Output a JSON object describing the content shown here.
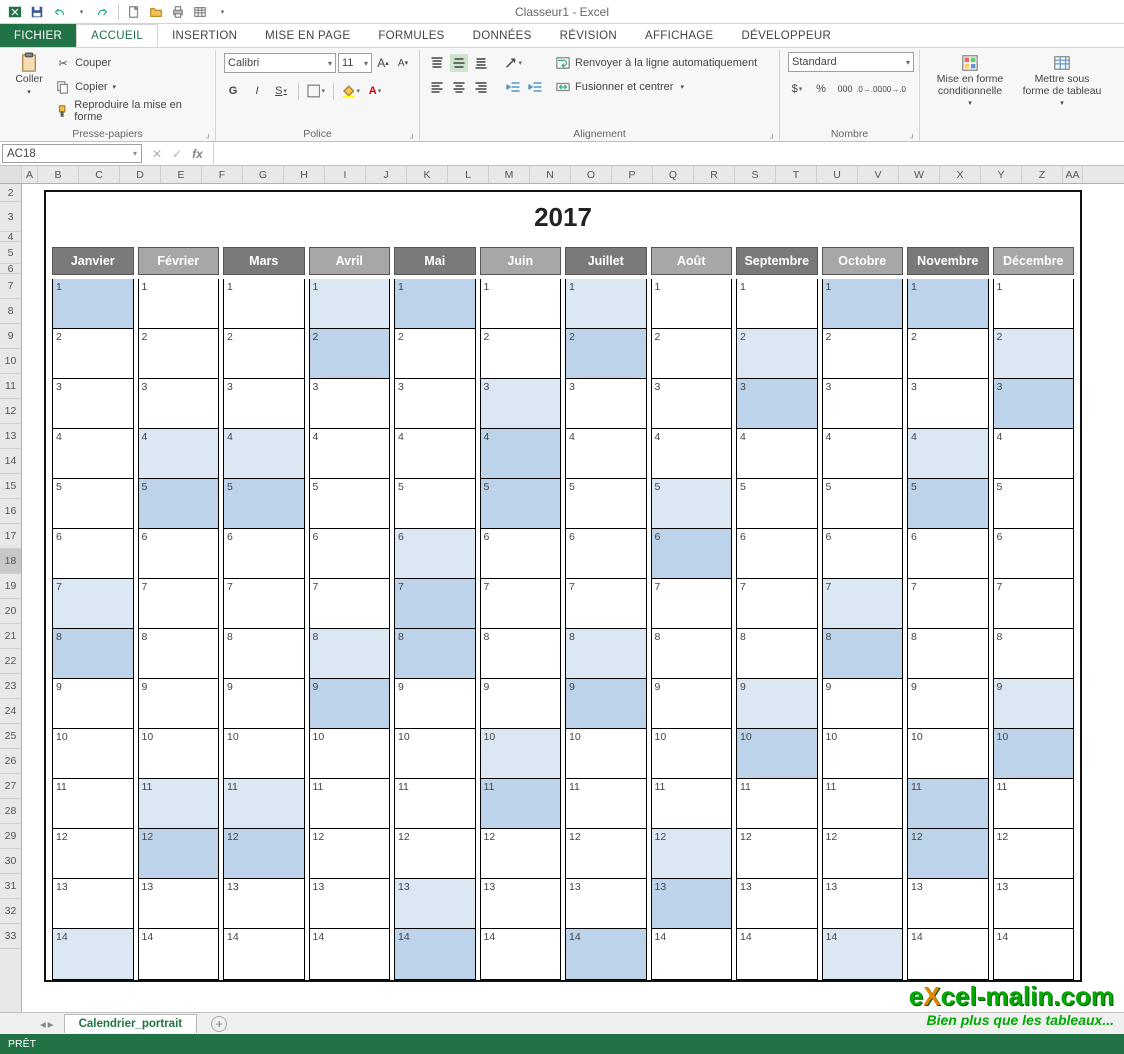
{
  "app": {
    "title": "Classeur1 - Excel"
  },
  "qat": {
    "icons": [
      "excel-icon",
      "save-icon",
      "undo-icon",
      "redo-icon",
      "sep",
      "new-icon",
      "open-icon",
      "print-preview-icon",
      "table-icon"
    ]
  },
  "tabs": {
    "file": "FICHIER",
    "items": [
      "ACCUEIL",
      "INSERTION",
      "MISE EN PAGE",
      "FORMULES",
      "DONNÉES",
      "RÉVISION",
      "AFFICHAGE",
      "DÉVELOPPEUR"
    ],
    "active": "ACCUEIL"
  },
  "ribbon": {
    "clipboard": {
      "paste": "Coller",
      "cut": "Couper",
      "copy": "Copier",
      "format_painter": "Reproduire la mise en forme",
      "label": "Presse-papiers"
    },
    "font": {
      "name": "Calibri",
      "size": "11",
      "label": "Police",
      "bold": "G",
      "italic": "I",
      "underline": "S"
    },
    "align": {
      "wrap": "Renvoyer à la ligne automatiquement",
      "merge": "Fusionner et centrer",
      "label": "Alignement"
    },
    "number": {
      "format": "Standard",
      "label": "Nombre"
    },
    "styles": {
      "cond": "Mise en forme conditionnelle",
      "table": "Mettre sous forme de tableau"
    }
  },
  "formula": {
    "cell": "AC18"
  },
  "columns": [
    "A",
    "B",
    "C",
    "D",
    "E",
    "F",
    "G",
    "H",
    "I",
    "J",
    "K",
    "L",
    "M",
    "N",
    "O",
    "P",
    "Q",
    "R",
    "S",
    "T",
    "U",
    "V",
    "W",
    "X",
    "Y",
    "Z",
    "AA"
  ],
  "rows_shown": [
    2,
    3,
    4,
    5,
    6,
    7,
    8,
    9,
    10,
    11,
    12,
    13,
    14,
    15,
    16,
    17,
    18,
    19,
    20,
    21,
    22,
    23,
    24,
    25,
    26,
    27,
    28,
    29,
    30,
    31,
    32,
    33
  ],
  "selected_row": 18,
  "sheet_tab": "Calendrier_portrait",
  "status": "PRÊT",
  "calendar": {
    "year": "2017",
    "months": [
      "Janvier",
      "Février",
      "Mars",
      "Avril",
      "Mai",
      "Juin",
      "Juillet",
      "Août",
      "Septembre",
      "Octobre",
      "Novembre",
      "Décembre"
    ],
    "days_visible": 14,
    "highlight": {
      "Janvier": {
        "1": 2,
        "7": 1,
        "8": 2,
        "14": 1
      },
      "Février": {
        "4": 1,
        "5": 2,
        "11": 1,
        "12": 2
      },
      "Mars": {
        "4": 1,
        "5": 2,
        "11": 1,
        "12": 2
      },
      "Avril": {
        "1": 1,
        "2": 2,
        "8": 1,
        "9": 2
      },
      "Mai": {
        "1": 2,
        "6": 1,
        "7": 2,
        "8": 2,
        "13": 1,
        "14": 2
      },
      "Juin": {
        "3": 1,
        "4": 2,
        "5": 2,
        "10": 1,
        "11": 2
      },
      "Juillet": {
        "1": 1,
        "2": 2,
        "8": 1,
        "9": 2,
        "14": 2
      },
      "Août": {
        "5": 1,
        "6": 2,
        "12": 1,
        "13": 2
      },
      "Septembre": {
        "2": 1,
        "3": 2,
        "9": 1,
        "10": 2
      },
      "Octobre": {
        "1": 2,
        "7": 1,
        "8": 2,
        "14": 1
      },
      "Novembre": {
        "1": 2,
        "4": 1,
        "5": 2,
        "11": 2,
        "12": 2
      },
      "Décembre": {
        "2": 1,
        "3": 2,
        "9": 1,
        "10": 2
      }
    }
  },
  "watermark": {
    "line1_a": "e",
    "line1_b": "X",
    "line1_c": "cel-malin.com",
    "line2": "Bien plus que les tableaux..."
  }
}
